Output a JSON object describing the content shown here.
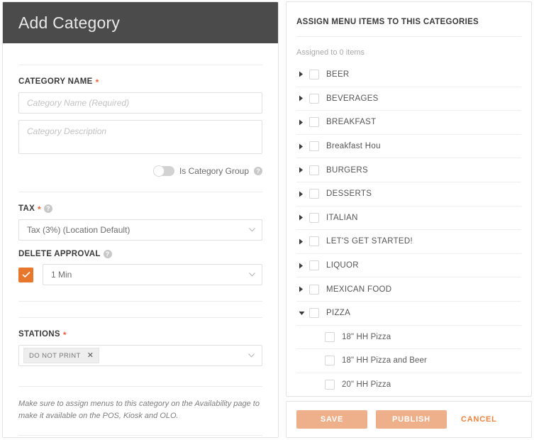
{
  "left": {
    "header_title": "Add Category",
    "category_name": {
      "label": "CATEGORY NAME",
      "required_mark": "*",
      "name_placeholder": "Category Name (Required)",
      "name_value": "",
      "description_placeholder": "Category Description",
      "description_value": ""
    },
    "category_group": {
      "label": "Is Category Group",
      "help_icon": "help-icon",
      "toggle_state": "off"
    },
    "tax": {
      "label": "TAX",
      "required_mark": "*",
      "help_icon": "help-icon",
      "selected": "Tax (3%) (Location Default)"
    },
    "delete_approval": {
      "label": "DELETE APPROVAL",
      "help_icon": "help-icon",
      "checkbox_state": "checked",
      "selected": "1 Min"
    },
    "stations": {
      "label": "STATIONS",
      "required_mark": "*",
      "chip_label": "DO NOT PRINT",
      "chip_remove_icon": "close-icon"
    },
    "note": "Make sure to assign menus to this category on the Availability page to make it available on the POS, Kiosk and OLO."
  },
  "right": {
    "title": "ASSIGN MENU ITEMS TO THIS CATEGORIES",
    "assigned_text": "Assigned to 0 items",
    "tree": [
      {
        "label": "BEER",
        "expanded": false,
        "checked": false,
        "child": false
      },
      {
        "label": "BEVERAGES",
        "expanded": false,
        "checked": false,
        "child": false
      },
      {
        "label": "BREAKFAST",
        "expanded": false,
        "checked": false,
        "child": false
      },
      {
        "label": "Breakfast Hou",
        "expanded": false,
        "checked": false,
        "child": false
      },
      {
        "label": "BURGERS",
        "expanded": false,
        "checked": false,
        "child": false
      },
      {
        "label": "DESSERTS",
        "expanded": false,
        "checked": false,
        "child": false
      },
      {
        "label": "ITALIAN",
        "expanded": false,
        "checked": false,
        "child": false
      },
      {
        "label": "LET'S GET STARTED!",
        "expanded": false,
        "checked": false,
        "child": false
      },
      {
        "label": "LIQUOR",
        "expanded": false,
        "checked": false,
        "child": false
      },
      {
        "label": "MEXICAN FOOD",
        "expanded": false,
        "checked": false,
        "child": false
      },
      {
        "label": "PIZZA",
        "expanded": true,
        "checked": false,
        "child": false
      },
      {
        "label": "18\" HH Pizza",
        "expanded": null,
        "checked": false,
        "child": true
      },
      {
        "label": "18\" HH Pizza and Beer",
        "expanded": null,
        "checked": false,
        "child": true
      },
      {
        "label": "20\" HH Pizza",
        "expanded": null,
        "checked": false,
        "child": true
      }
    ],
    "footer": {
      "save_label": "SAVE",
      "publish_label": "PUBLISH",
      "cancel_label": "CANCEL"
    }
  },
  "colors": {
    "header_bg": "#4b4b4b",
    "accent_orange": "#e8772e",
    "button_peach": "#eeb08a",
    "cancel_orange": "#e8833f",
    "required_red": "#f0603c"
  }
}
